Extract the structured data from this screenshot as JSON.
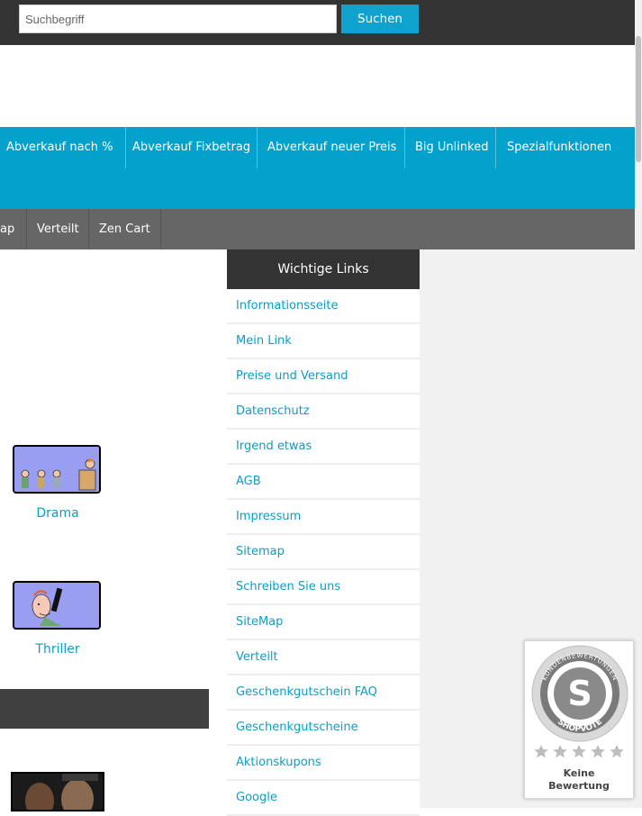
{
  "search": {
    "placeholder": "Suchbegriff",
    "button_label": "Suchen"
  },
  "nav_primary": [
    "Abverkauf nach %",
    "Abverkauf Fixbetrag",
    "Abverkauf neuer Preis",
    "Big Unlinked",
    "Spezialfunktionen"
  ],
  "nav_secondary": [
    "ap",
    "Verteilt",
    "Zen Cart"
  ],
  "sidebox": {
    "title": "Wichtige Links",
    "links": [
      "Informationsseite",
      "Mein Link",
      "Preise und Versand",
      "Datenschutz",
      "Irgend etwas",
      "AGB",
      "Impressum",
      "Sitemap",
      "Schreiben Sie uns",
      "SiteMap",
      "Verteilt",
      "Geschenkgutschein FAQ",
      "Geschenkgutscheine",
      "Aktionskupons",
      "Google"
    ]
  },
  "categories": [
    {
      "label": "Drama"
    },
    {
      "label": "Thriller"
    }
  ],
  "rating_badge": {
    "ring_text": "KUNDENBEWERTUNGEN",
    "brand": "SHOPVOTE",
    "line1": "Keine",
    "line2": "Bewertung",
    "stars": 5
  },
  "colors": {
    "accent": "#03a2cc",
    "link": "#0c9ec4",
    "dark": "#333333",
    "grey_nav": "#666666"
  }
}
